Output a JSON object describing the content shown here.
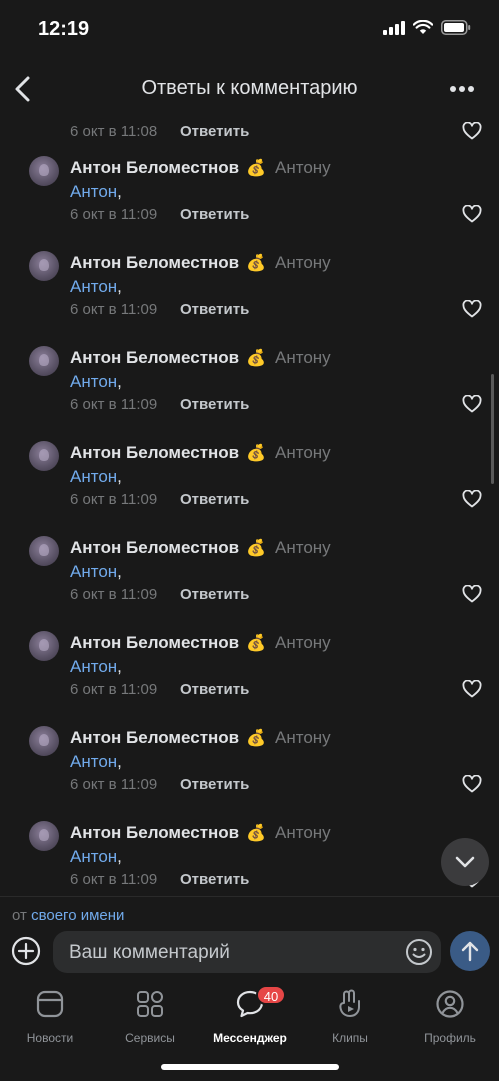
{
  "status_bar": {
    "time": "12:19"
  },
  "header": {
    "title": "Ответы к комментарию",
    "back_icon": "chevron-left-icon",
    "more_icon": "more-horizontal-icon"
  },
  "partial_comment": {
    "date": "6 окт в 11:08",
    "reply_label": "Ответить"
  },
  "comments": [
    {
      "author": "Антон Беломестнов",
      "emoji": "💰",
      "reply_to": "Антону",
      "mention": "Антон",
      "suffix": ",",
      "date": "6 окт в 11:09",
      "reply_label": "Ответить"
    },
    {
      "author": "Антон Беломестнов",
      "emoji": "💰",
      "reply_to": "Антону",
      "mention": "Антон",
      "suffix": ",",
      "date": "6 окт в 11:09",
      "reply_label": "Ответить"
    },
    {
      "author": "Антон Беломестнов",
      "emoji": "💰",
      "reply_to": "Антону",
      "mention": "Антон",
      "suffix": ",",
      "date": "6 окт в 11:09",
      "reply_label": "Ответить"
    },
    {
      "author": "Антон Беломестнов",
      "emoji": "💰",
      "reply_to": "Антону",
      "mention": "Антон",
      "suffix": ",",
      "date": "6 окт в 11:09",
      "reply_label": "Ответить"
    },
    {
      "author": "Антон Беломестнов",
      "emoji": "💰",
      "reply_to": "Антону",
      "mention": "Антон",
      "suffix": ",",
      "date": "6 окт в 11:09",
      "reply_label": "Ответить"
    },
    {
      "author": "Антон Беломестнов",
      "emoji": "💰",
      "reply_to": "Антону",
      "mention": "Антон",
      "suffix": ",",
      "date": "6 окт в 11:09",
      "reply_label": "Ответить"
    },
    {
      "author": "Антон Беломестнов",
      "emoji": "💰",
      "reply_to": "Антону",
      "mention": "Антон",
      "suffix": ",",
      "date": "6 окт в 11:09",
      "reply_label": "Ответить"
    },
    {
      "author": "Антон Беломестнов",
      "emoji": "💰",
      "reply_to": "Антону",
      "mention": "Антон",
      "suffix": ",",
      "date": "6 окт в 11:09",
      "reply_label": "Ответить"
    }
  ],
  "composer": {
    "from_prefix": "от",
    "from_link": "своего имени",
    "placeholder": "Ваш комментарий",
    "add_icon": "plus-circle-icon",
    "emoji_icon": "smile-icon",
    "send_icon": "arrow-up-icon"
  },
  "tabbar": {
    "tabs": [
      {
        "label": "Новости",
        "icon": "news-icon"
      },
      {
        "label": "Сервисы",
        "icon": "services-icon"
      },
      {
        "label": "Мессенджер",
        "icon": "messenger-icon",
        "badge": "40",
        "active": true
      },
      {
        "label": "Клипы",
        "icon": "clips-icon"
      },
      {
        "label": "Профиль",
        "icon": "profile-icon"
      }
    ]
  },
  "colors": {
    "background": "#191919",
    "link": "#71aaeb",
    "badge": "#e64646",
    "send_button": "#3a5b86"
  }
}
